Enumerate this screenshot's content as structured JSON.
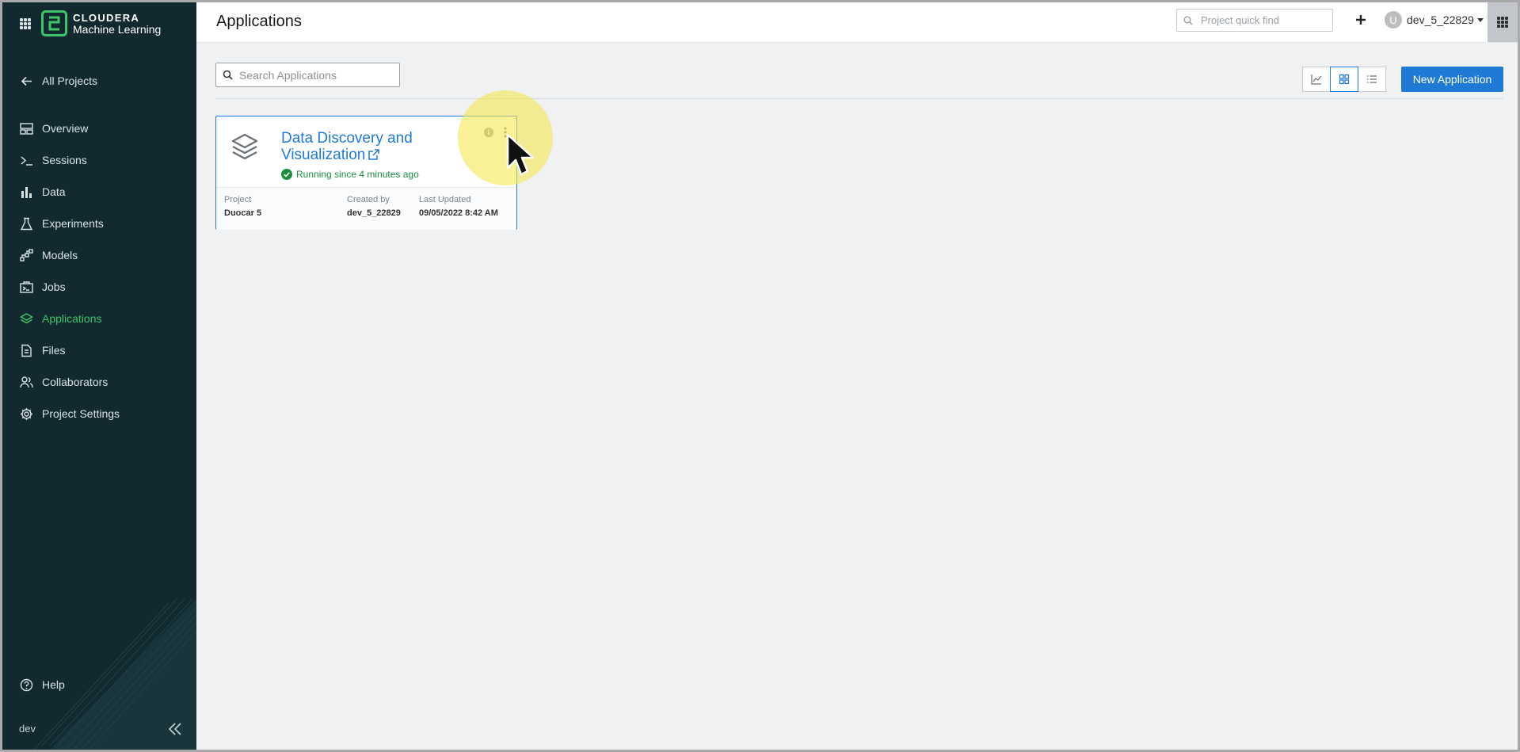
{
  "brand": {
    "line1": "CLOUDERA",
    "line2": "Machine Learning"
  },
  "sidebar": {
    "back_label": "All Projects",
    "items": [
      {
        "label": "Overview",
        "icon": "overview-icon"
      },
      {
        "label": "Sessions",
        "icon": "terminal-icon"
      },
      {
        "label": "Data",
        "icon": "bar-chart-icon"
      },
      {
        "label": "Experiments",
        "icon": "flask-icon"
      },
      {
        "label": "Models",
        "icon": "model-icon"
      },
      {
        "label": "Jobs",
        "icon": "jobs-icon"
      },
      {
        "label": "Applications",
        "icon": "layers-icon",
        "active": true
      },
      {
        "label": "Files",
        "icon": "file-icon"
      },
      {
        "label": "Collaborators",
        "icon": "people-icon"
      },
      {
        "label": "Project Settings",
        "icon": "gear-icon"
      }
    ],
    "help_label": "Help",
    "env_label": "dev"
  },
  "header": {
    "title": "Applications",
    "quickfind_placeholder": "Project quick find",
    "user_initial": "U",
    "username": "dev_5_22829"
  },
  "toolbar": {
    "search_placeholder": "Search Applications",
    "new_app_label": "New Application",
    "view_modes": [
      "chart-view",
      "grid-view",
      "list-view"
    ],
    "active_view": "grid-view"
  },
  "cards": [
    {
      "title": "Data Discovery and Visualization",
      "status": "Running since 4 minutes ago",
      "project_label": "Project",
      "project": "Duocar 5",
      "created_by_label": "Created by",
      "created_by": "dev_5_22829",
      "updated_label": "Last Updated",
      "updated": "09/05/2022 8:42 AM"
    }
  ],
  "colors": {
    "accent": "#1f7ad6",
    "sidebar_bg": "#122a2f",
    "active_nav": "#3fc56a",
    "running": "#1b8e3d"
  }
}
